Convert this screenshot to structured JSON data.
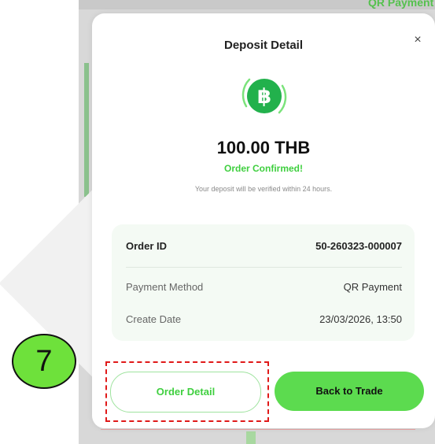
{
  "background": {
    "topright_text": "QR Payment"
  },
  "modal": {
    "title": "Deposit Detail",
    "close_glyph": "×",
    "coin_icon": "bitcoin-icon",
    "amount": "100.00 THB",
    "status": "Order Confirmed!",
    "note": "Your deposit will be verified within 24 hours.",
    "details": [
      {
        "label": "Order ID",
        "value": "50-260323-000007"
      },
      {
        "label": "Payment Method",
        "value": "QR Payment"
      },
      {
        "label": "Create Date",
        "value": "23/03/2026, 13:50"
      }
    ],
    "buttons": {
      "order_detail": "Order Detail",
      "back_to_trade": "Back to Trade"
    }
  },
  "annotation": {
    "step_number": "7"
  },
  "colors": {
    "accent_green": "#5cdb4f",
    "status_green": "#3fcf3f",
    "annotation_red": "#e01919"
  }
}
